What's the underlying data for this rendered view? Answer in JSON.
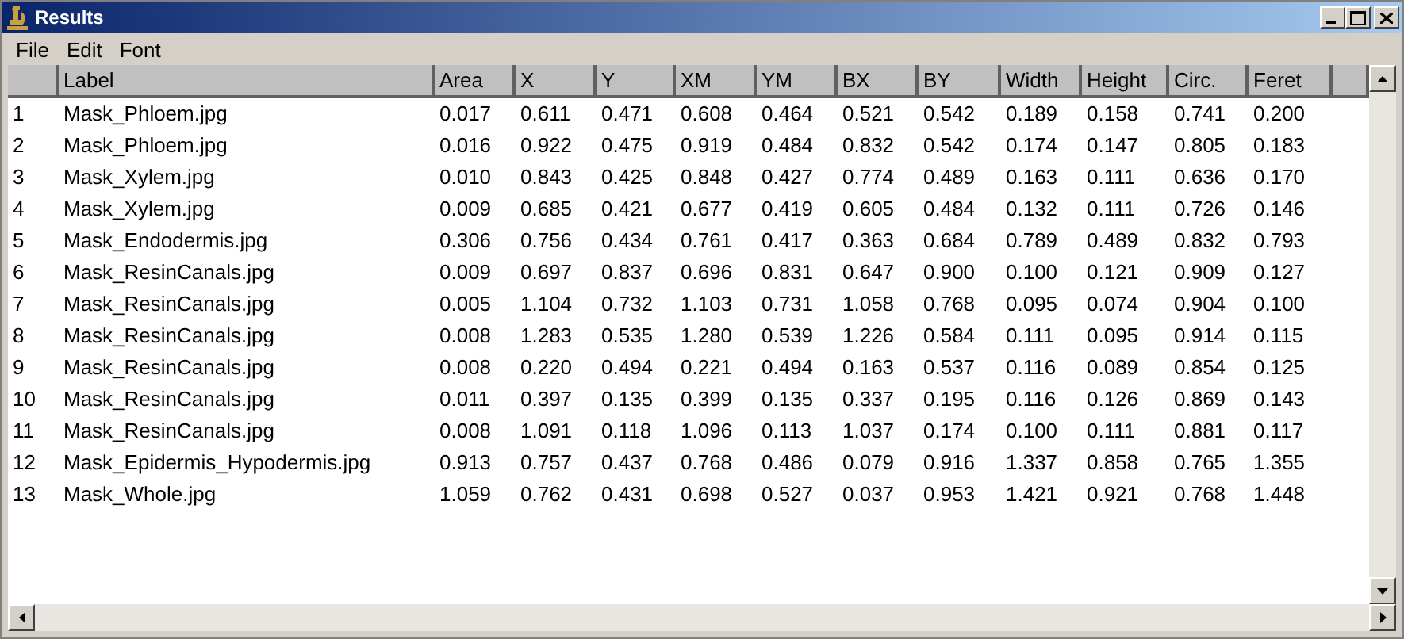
{
  "window": {
    "title": "Results"
  },
  "menu": [
    "File",
    "Edit",
    "Font"
  ],
  "table": {
    "columns": [
      "Label",
      "Area",
      "X",
      "Y",
      "XM",
      "YM",
      "BX",
      "BY",
      "Width",
      "Height",
      "Circ.",
      "Feret"
    ],
    "rows": [
      {
        "index": "1",
        "cells": [
          "Mask_Phloem.jpg",
          "0.017",
          "0.611",
          "0.471",
          "0.608",
          "0.464",
          "0.521",
          "0.542",
          "0.189",
          "0.158",
          "0.741",
          "0.200"
        ]
      },
      {
        "index": "2",
        "cells": [
          "Mask_Phloem.jpg",
          "0.016",
          "0.922",
          "0.475",
          "0.919",
          "0.484",
          "0.832",
          "0.542",
          "0.174",
          "0.147",
          "0.805",
          "0.183"
        ]
      },
      {
        "index": "3",
        "cells": [
          "Mask_Xylem.jpg",
          "0.010",
          "0.843",
          "0.425",
          "0.848",
          "0.427",
          "0.774",
          "0.489",
          "0.163",
          "0.111",
          "0.636",
          "0.170"
        ]
      },
      {
        "index": "4",
        "cells": [
          "Mask_Xylem.jpg",
          "0.009",
          "0.685",
          "0.421",
          "0.677",
          "0.419",
          "0.605",
          "0.484",
          "0.132",
          "0.111",
          "0.726",
          "0.146"
        ]
      },
      {
        "index": "5",
        "cells": [
          "Mask_Endodermis.jpg",
          "0.306",
          "0.756",
          "0.434",
          "0.761",
          "0.417",
          "0.363",
          "0.684",
          "0.789",
          "0.489",
          "0.832",
          "0.793"
        ]
      },
      {
        "index": "6",
        "cells": [
          "Mask_ResinCanals.jpg",
          "0.009",
          "0.697",
          "0.837",
          "0.696",
          "0.831",
          "0.647",
          "0.900",
          "0.100",
          "0.121",
          "0.909",
          "0.127"
        ]
      },
      {
        "index": "7",
        "cells": [
          "Mask_ResinCanals.jpg",
          "0.005",
          "1.104",
          "0.732",
          "1.103",
          "0.731",
          "1.058",
          "0.768",
          "0.095",
          "0.074",
          "0.904",
          "0.100"
        ]
      },
      {
        "index": "8",
        "cells": [
          "Mask_ResinCanals.jpg",
          "0.008",
          "1.283",
          "0.535",
          "1.280",
          "0.539",
          "1.226",
          "0.584",
          "0.111",
          "0.095",
          "0.914",
          "0.115"
        ]
      },
      {
        "index": "9",
        "cells": [
          "Mask_ResinCanals.jpg",
          "0.008",
          "0.220",
          "0.494",
          "0.221",
          "0.494",
          "0.163",
          "0.537",
          "0.116",
          "0.089",
          "0.854",
          "0.125"
        ]
      },
      {
        "index": "10",
        "cells": [
          "Mask_ResinCanals.jpg",
          "0.011",
          "0.397",
          "0.135",
          "0.399",
          "0.135",
          "0.337",
          "0.195",
          "0.116",
          "0.126",
          "0.869",
          "0.143"
        ]
      },
      {
        "index": "11",
        "cells": [
          "Mask_ResinCanals.jpg",
          "0.008",
          "1.091",
          "0.118",
          "1.096",
          "0.113",
          "1.037",
          "0.174",
          "0.100",
          "0.111",
          "0.881",
          "0.117"
        ]
      },
      {
        "index": "12",
        "cells": [
          "Mask_Epidermis_Hypodermis.jpg",
          "0.913",
          "0.757",
          "0.437",
          "0.768",
          "0.486",
          "0.079",
          "0.916",
          "1.337",
          "0.858",
          "0.765",
          "1.355"
        ]
      },
      {
        "index": "13",
        "cells": [
          "Mask_Whole.jpg",
          "1.059",
          "0.762",
          "0.431",
          "0.698",
          "0.527",
          "0.037",
          "0.953",
          "1.421",
          "0.921",
          "0.768",
          "1.448"
        ]
      }
    ]
  }
}
